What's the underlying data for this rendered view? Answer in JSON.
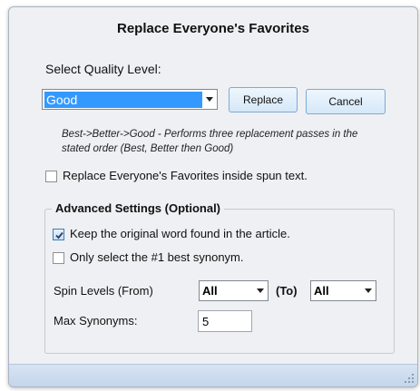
{
  "dialog": {
    "title": "Replace Everyone's Favorites",
    "quality_label": "Select Quality Level:",
    "quality_value": "Good",
    "replace_label": "Replace",
    "cancel_label": "Cancel",
    "hint": "Best->Better->Good - Performs three replacement passes in the stated order (Best, Better then Good)",
    "spun_text_option": {
      "label": "Replace Everyone's Favorites inside spun text.",
      "checked": false
    }
  },
  "advanced": {
    "title": "Advanced Settings (Optional)",
    "keep_original": {
      "label": "Keep the original word found in the article.",
      "checked": true
    },
    "only_best": {
      "label": "Only select the #1 best synonym.",
      "checked": false
    },
    "spin_levels_label": "Spin Levels (From)",
    "from_value": "All",
    "to_label": "(To)",
    "to_value": "All",
    "max_synonyms_label": "Max Synonyms:",
    "max_synonyms_value": "5"
  },
  "colors": {
    "accent": "#3399ff",
    "window_bg": "#eef0f3",
    "status_bar": "#c4d5eb"
  }
}
